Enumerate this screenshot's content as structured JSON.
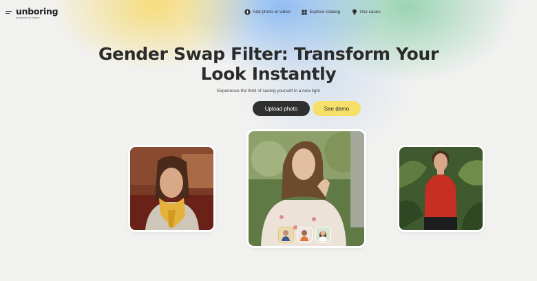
{
  "brand": {
    "name": "unboring",
    "tagline": "powered by reface"
  },
  "nav": {
    "items": [
      {
        "label": "Add photo or video",
        "icon": "plus-circle-icon"
      },
      {
        "label": "Explore catalog",
        "icon": "grid-icon"
      },
      {
        "label": "Use cases",
        "icon": "lightbulb-icon"
      }
    ]
  },
  "hero": {
    "title_line1": "Gender Swap Filter: Transform Your",
    "title_line2": "Look Instantly",
    "subtitle": "Experience the thrill of seeing yourself in a new light",
    "upload_label": "Upload photo",
    "demo_label": "See demo"
  },
  "colors": {
    "primary_button": "#2f2f2f",
    "secondary_button": "#f7e06a",
    "thumb_active_border": "#f2c94c",
    "background": "#f1f1f0"
  },
  "gallery": {
    "left_card": "person-yellow-scarf-photo",
    "center_card": "person-floral-dress-photo",
    "right_card": "person-red-shirt-photo",
    "thumbnails": [
      "face-thumbnail-1",
      "face-thumbnail-2",
      "face-thumbnail-3"
    ],
    "active_thumbnail": 0
  }
}
